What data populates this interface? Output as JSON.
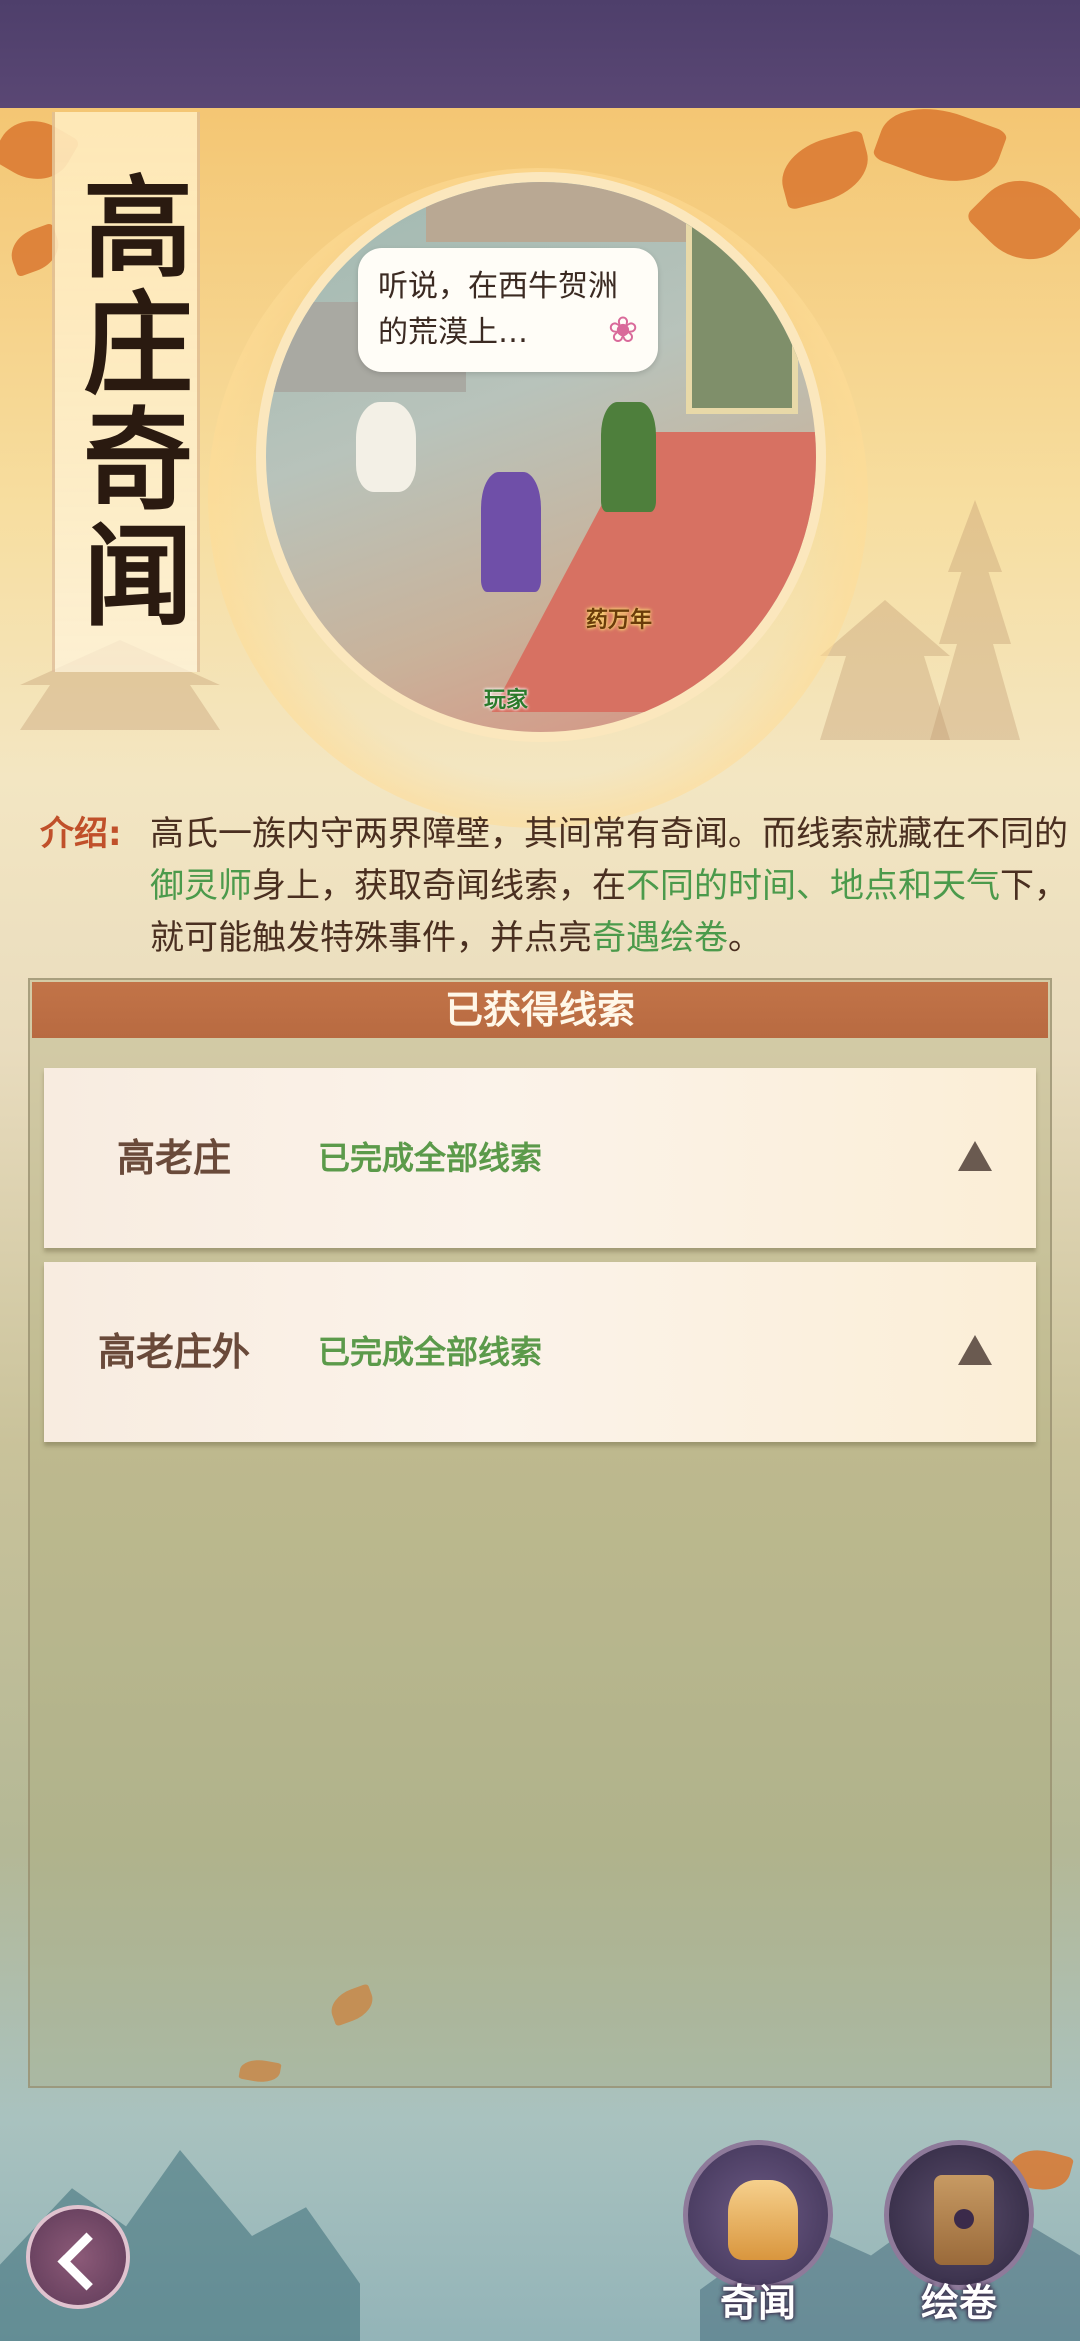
{
  "header": {
    "title": "高庄奇闻"
  },
  "scene": {
    "speech_bubble": "听说，在西牛贺洲的荒漠上…",
    "player_label": "玩家",
    "npc_label": "药万年"
  },
  "intro": {
    "label": "介绍:",
    "segments": [
      {
        "text": "高氏一族内守两界障壁，其间常有奇闻。而线索就藏在不同的",
        "highlight": false
      },
      {
        "text": "御灵师",
        "highlight": true
      },
      {
        "text": "身上，获取奇闻线索，在",
        "highlight": false
      },
      {
        "text": "不同的时间、地点和天气",
        "highlight": true
      },
      {
        "text": "下，就可能触发特殊事件，并点亮",
        "highlight": false
      },
      {
        "text": "奇遇绘卷",
        "highlight": true
      },
      {
        "text": "。",
        "highlight": false
      }
    ]
  },
  "clues": {
    "header": "已获得线索",
    "rows": [
      {
        "place": "高老庄",
        "status": "已完成全部线索"
      },
      {
        "place": "高老庄外",
        "status": "已完成全部线索"
      }
    ]
  },
  "bottom_nav": {
    "qiwen_label": "奇闻",
    "huijuan_label": "绘卷"
  },
  "colors": {
    "accent_header": "#c27448",
    "highlight_green": "#4b9a4b",
    "intro_label": "#c0502a"
  },
  "icons": {
    "back": "back-arrow-icon",
    "qiwen": "bell-icon",
    "huijuan": "scroll-icon",
    "expand": "chevron-up-icon"
  }
}
